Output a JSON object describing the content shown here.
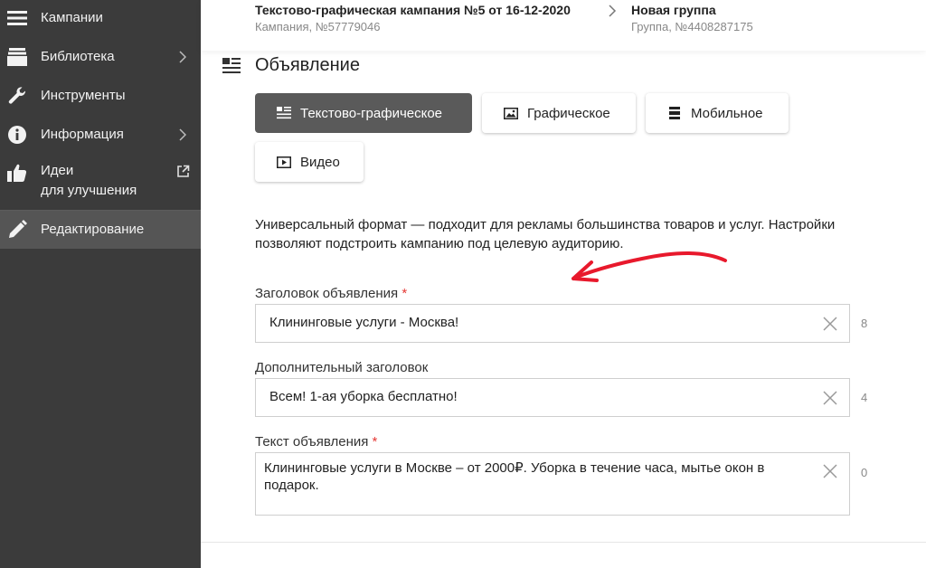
{
  "sidebar": {
    "items": [
      {
        "label": "Кампании",
        "icon": "menu-icon"
      },
      {
        "label": "Библиотека",
        "icon": "library-icon"
      },
      {
        "label": "Инструменты",
        "icon": "wrench-icon"
      },
      {
        "label": "Информация",
        "icon": "info-icon"
      },
      {
        "label": "Идеи",
        "label2": "для улучшения",
        "icon": "thumb-up-icon"
      },
      {
        "label": "Редактирование",
        "icon": "pencil-icon"
      }
    ]
  },
  "header": {
    "campaign_title": "Текстово-графическая кампания №5 от 16-12-2020",
    "campaign_sub": "Кампания, №57779046",
    "group_title": "Новая группа",
    "group_sub": "Группа, №4408287175"
  },
  "section": {
    "title": "Объявление"
  },
  "formats": [
    {
      "label": "Текстово-графическое",
      "active": true
    },
    {
      "label": "Графическое",
      "active": false
    },
    {
      "label": "Мобильное",
      "active": false
    },
    {
      "label": "Видео",
      "active": false
    }
  ],
  "description": "Универсальный формат — подходит для рекламы большинства товаров и услуг. Настройки позволяют подстроить кампанию под целевую аудиторию.",
  "fields": {
    "headline": {
      "label": "Заголовок объявления",
      "required": "*",
      "value": "Клининговые услуги - Москва!",
      "counter": "8"
    },
    "subheadline": {
      "label": "Дополнительный заголовок",
      "value": "Всем! 1-ая уборка бесплатно!",
      "counter": "4"
    },
    "text": {
      "label": "Текст объявления",
      "required": "*",
      "value": "Клининговые услуги в Москве – от 2000₽. Уборка в течение часа, мытье окон в подарок.",
      "counter": "0"
    }
  },
  "colors": {
    "sidebar_bg": "#3b3b3b",
    "active_item": "#555555",
    "required": "#e53935",
    "annotation_arrow": "#e8192c"
  }
}
